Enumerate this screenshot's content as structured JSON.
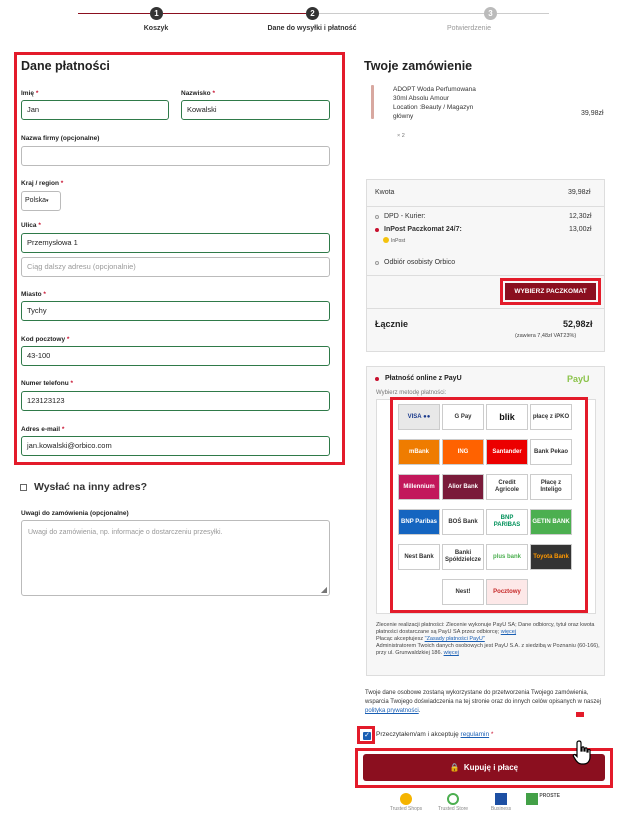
{
  "stepper": {
    "steps": [
      {
        "num": "1",
        "label": "Koszyk"
      },
      {
        "num": "2",
        "label": "Dane do wysyłki i płatność"
      },
      {
        "num": "3",
        "label": "Potwierdzenie"
      }
    ]
  },
  "billing": {
    "title": "Dane płatności",
    "first_name": {
      "label": "Imię",
      "req": "*",
      "value": "Jan"
    },
    "last_name": {
      "label": "Nazwisko",
      "req": "*",
      "value": "Kowalski"
    },
    "company": {
      "label": "Nazwa firmy (opcjonalne)",
      "value": ""
    },
    "country": {
      "label": "Kraj / region",
      "req": "*",
      "value": "Polska"
    },
    "street": {
      "label": "Ulica",
      "req": "*",
      "value": "Przemysłowa 1",
      "placeholder2": "Ciąg dalszy adresu (opcjonalnie)"
    },
    "city": {
      "label": "Miasto",
      "req": "*",
      "value": "Tychy"
    },
    "postcode": {
      "label": "Kod pocztowy",
      "req": "*",
      "value": "43-100"
    },
    "phone": {
      "label": "Numer telefonu",
      "req": "*",
      "value": "123123123"
    },
    "email": {
      "label": "Adres e-mail",
      "req": "*",
      "value": "jan.kowalski@orbico.com"
    }
  },
  "ship_other": {
    "label": "Wysłać na inny adres?"
  },
  "notes": {
    "label": "Uwagi do zamówienia (opcjonalne)",
    "placeholder": "Uwagi do zamówienia, np. informacje o dostarczeniu przesyłki."
  },
  "order": {
    "title": "Twoje zamówienie",
    "product": {
      "name1": "ADOPT Woda Perfumowana",
      "name2": "30ml Absolu Amour",
      "loc1": "Location :Beauty / Magazyn",
      "loc2": "główny",
      "qty": "× 2",
      "price": "39,98zł"
    },
    "amount_label": "Kwota",
    "amount": "39,98zł",
    "ship1": {
      "label": "DPD - Kurier:",
      "price": "12,30zł"
    },
    "ship2": {
      "label": "InPost Paczkomat 24/7:",
      "price": "13,00zł",
      "logo": "InPost"
    },
    "ship3": {
      "label": "Odbiór osobisty Orbico"
    },
    "locker_button": "WYBIERZ PACZKOMAT",
    "total_label": "Łącznie",
    "total": "52,98zł",
    "vat": "(zawiera 7,48zł VAT23%)"
  },
  "payment": {
    "label": "Płatność online z PayU",
    "logo": "PayU",
    "choose": "Wybierz metodę płatności:",
    "methods": [
      [
        "VISA ●●",
        "G Pay",
        "blik",
        "płacę z iPKO"
      ],
      [
        "mBank",
        "ING",
        "Santander",
        "Bank Pekao"
      ],
      [
        "Millennium",
        "Alior Bank",
        "Credit Agricole",
        "Płacę z Inteligo"
      ],
      [
        "BNP Paribas",
        "BOŚ Bank",
        "BNP PARIBAS",
        "GETIN BANK"
      ],
      [
        "Nest Bank",
        "Banki Spółdzielcze",
        "plus bank",
        "Toyota Bank"
      ],
      [
        "Nest!",
        "Pocztowy"
      ]
    ],
    "fine1": "Zlecenie realizacji płatności: Zlecenie wykonuje PayU SA; Dane odbiorcy, tytuł oraz kwota płatności dostarczane są PayU SA przez odbiorcę;",
    "fine1_link": "więcej",
    "fine2": "Płacąc akceptujesz",
    "fine2_link": "\"Zasady płatności PayU\"",
    "fine3": "Administratorem Twoich danych osobowych jest PayU S.A. z siedzibą w Poznaniu (60-166), przy ul. Grunwaldzkiej 186.",
    "fine3_link": "więcej"
  },
  "privacy": {
    "text": "Twoje dane osobowe zostaną wykorzystane do przetworzenia Twojego zamówienia, wsparcia Twojego doświadczenia na tej stronie oraz do innych celów opisanych w naszej",
    "link": "polityka prywatności"
  },
  "terms": {
    "text": "Przeczytałem/am i akceptuję",
    "link": "regulamin",
    "req": "*"
  },
  "buy_button": "Kupuję i płacę",
  "trust": [
    "Trusted Shops",
    "Trusted Store",
    "Business",
    "PROSTE"
  ],
  "colors": {
    "brand": "#8b0f1f",
    "annotation": "#e31b2a",
    "valid": "#2f7a49",
    "link": "#1a5fb4"
  }
}
